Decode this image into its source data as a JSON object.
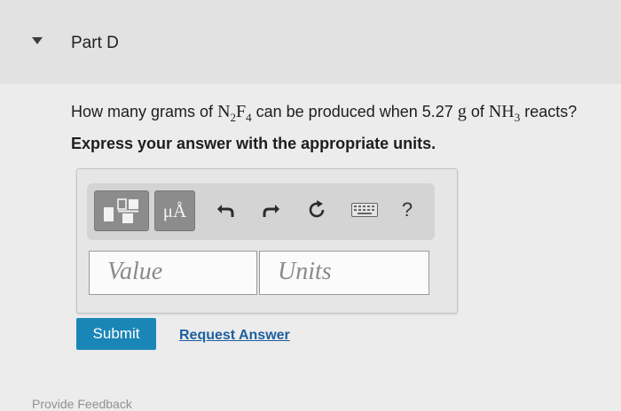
{
  "part": {
    "title": "Part D",
    "toggle_icon": "caret-down-icon"
  },
  "question": {
    "prefix": "How many grams of ",
    "product": {
      "a": "N",
      "a_sub": "2",
      "b": "F",
      "b_sub": "4"
    },
    "middle": " can be produced when 5.27 ",
    "unit": "g",
    "middle2": " of ",
    "reactant": {
      "a": "NH",
      "a_sub": "3"
    },
    "suffix": " reacts?"
  },
  "instruction": "Express your answer with the appropriate units.",
  "toolbar": {
    "units_label": "μÅ",
    "help_label": "?",
    "icons": [
      "templates-icon",
      "units-icon",
      "undo-icon",
      "redo-icon",
      "reset-icon",
      "keyboard-icon",
      "help-icon"
    ]
  },
  "answer": {
    "value_placeholder": "Value",
    "units_placeholder": "Units"
  },
  "actions": {
    "submit_label": "Submit",
    "request_answer_label": "Request Answer"
  },
  "footer": {
    "cutoff_text": "Provide Feedback"
  },
  "colors": {
    "submit_bg": "#1a86b8",
    "link": "#1d5f9d",
    "toolbar_button": "#8c8c8c"
  }
}
